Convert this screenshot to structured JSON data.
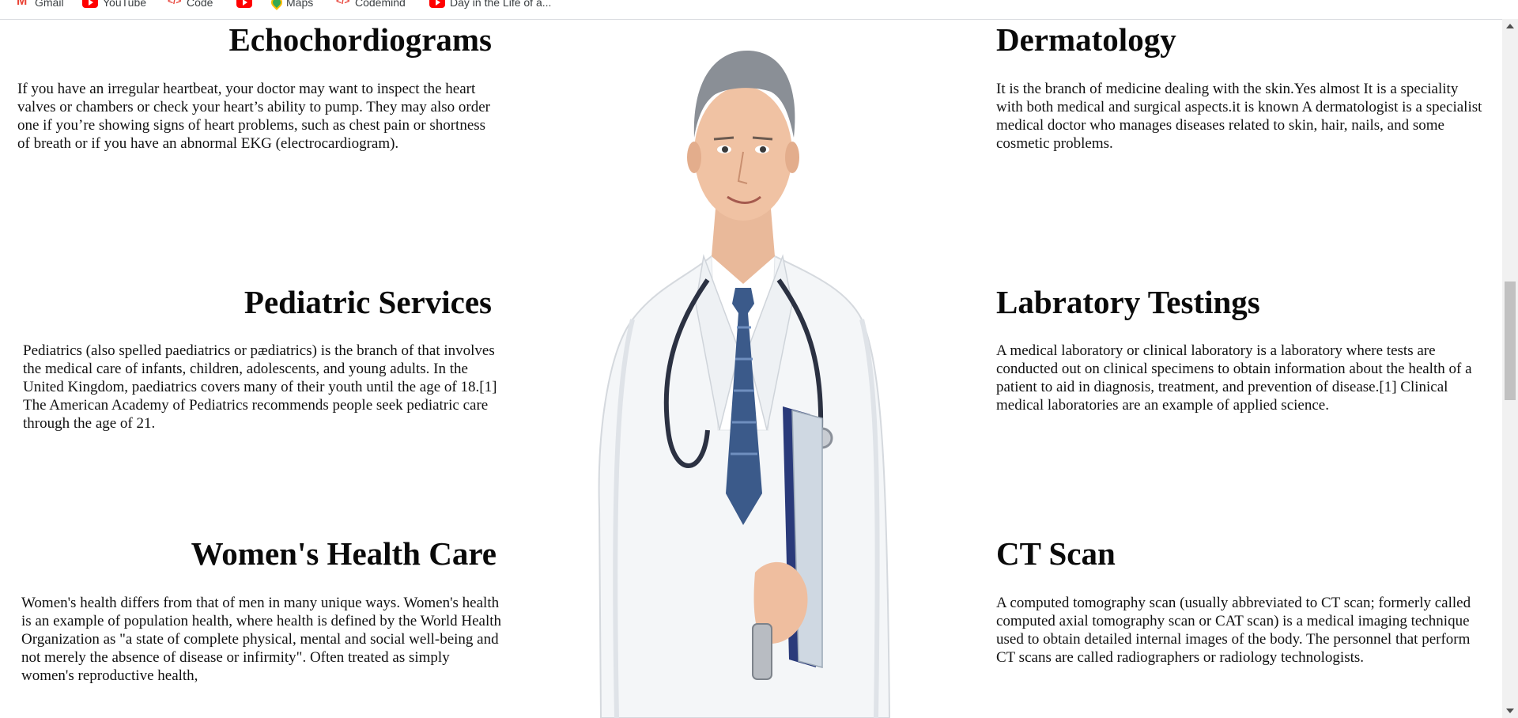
{
  "bookmarks": [
    {
      "label": "Gmail",
      "icon": "gmail-icon"
    },
    {
      "label": "YouTube",
      "icon": "youtube-icon"
    },
    {
      "label": "Code",
      "icon": "code-icon"
    },
    {
      "label": "",
      "icon": "youtube-icon"
    },
    {
      "label": "Maps",
      "icon": "maps-icon"
    },
    {
      "label": "Codemind",
      "icon": "code-icon"
    },
    {
      "label": "Day in the Life of a...",
      "icon": "youtube-icon"
    }
  ],
  "services": {
    "echo": {
      "title": "Echochordiograms",
      "text": "If you have an irregular heartbeat, your doctor may want to inspect the heart valves or chambers or check your heart’s ability to pump. They may also order one if you’re showing signs of heart problems, such as chest pain or shortness of breath or if you have an abnormal EKG (electrocardiogram)."
    },
    "pediatric": {
      "title": "Pediatric Services",
      "text": "Pediatrics (also spelled paediatrics or pædiatrics) is the branch of that involves the medical care of infants, children, adolescents, and young adults. In the United Kingdom, paediatrics covers many of their youth until the age of 18.[1] The American Academy of Pediatrics recommends people seek pediatric care through the age of 21."
    },
    "womens": {
      "title": "Women's Health Care",
      "text": "Women's health differs from that of men in many unique ways. Women's health is an example of population health, where health is defined by the World Health Organization as \"a state of complete physical, mental and social well-being and not merely the absence of disease or infirmity\". Often treated as simply women's reproductive health,"
    },
    "derma": {
      "title": "Dermatology",
      "text": "It is the branch of medicine dealing with the skin.Yes almost It is a speciality with both medical and surgical aspects.it is known A dermatologist is a specialist medical doctor who manages diseases related to skin, hair, nails, and some cosmetic problems."
    },
    "lab": {
      "title": "Labratory Testings",
      "text": "A medical laboratory or clinical laboratory is a laboratory where tests are conducted out on clinical specimens to obtain information about the health of a patient to aid in diagnosis, treatment, and prevention of disease.[1] Clinical medical laboratories are an example of applied science."
    },
    "ct": {
      "title": "CT Scan",
      "text": "A computed tomography scan (usually abbreviated to CT scan; formerly called computed axial tomography scan or CAT scan) is a medical imaging technique used to obtain detailed internal images of the body. The personnel that perform CT scans are called radiographers or radiology technologists."
    }
  },
  "colors": {
    "background": "#ffffff",
    "heading": "#0a0a0a",
    "coat": "#f4f6f8",
    "tie": "#3b5a8a",
    "folder": "#2a3a7a"
  }
}
